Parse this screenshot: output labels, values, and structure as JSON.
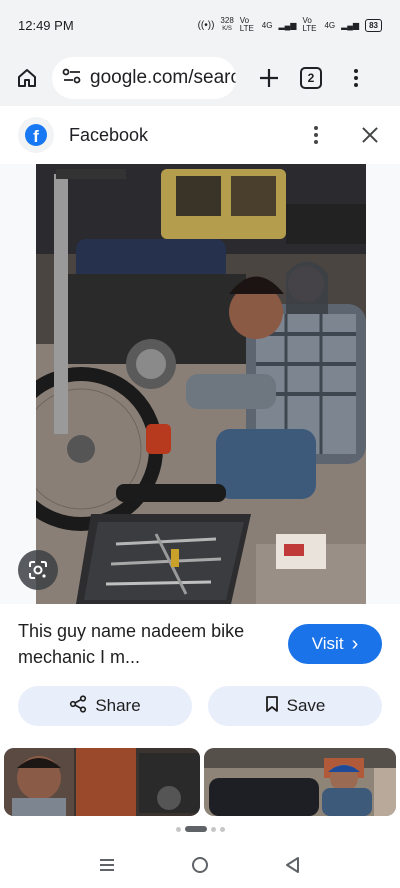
{
  "status_bar": {
    "time": "12:49 PM",
    "speed_top": "328",
    "speed_unit": "K/S",
    "sim1": "Vo LTE",
    "sim1_net": "4G",
    "sim2": "Vo LTE",
    "sim2_net": "4G",
    "battery": "83"
  },
  "browser": {
    "url": "google.com/search",
    "tab_count": "2"
  },
  "source": {
    "name": "Facebook",
    "logo_letter": "f"
  },
  "result": {
    "caption": "This guy name nadeem bike mechanic I m...",
    "visit_label": "Visit",
    "visit_arrow": "›"
  },
  "actions": {
    "share_label": "Share",
    "save_label": "Save"
  },
  "colors": {
    "accent": "#1a73e8",
    "chip_bg": "#e8eefa",
    "toolbar_bg": "#f1f3f4"
  },
  "icons": {
    "home": "home-icon",
    "site_info": "tune-icon",
    "new_tab": "plus-icon",
    "menu": "more-vert-icon",
    "lens": "google-lens-icon",
    "share": "share-icon",
    "save": "bookmark-icon",
    "nav_recent": "recents-icon",
    "nav_home": "home-circle-icon",
    "nav_back": "back-icon"
  }
}
